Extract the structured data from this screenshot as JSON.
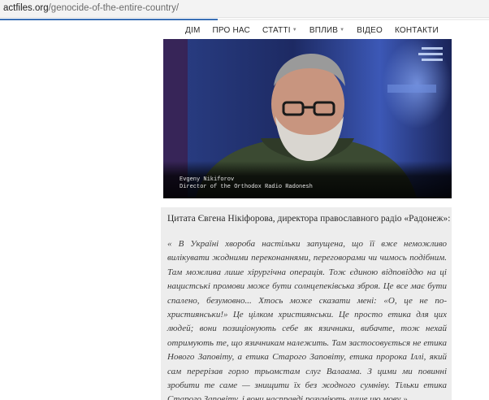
{
  "browser": {
    "url_domain": "actfiles.org",
    "url_path": "/genocide-of-the-entire-country/"
  },
  "nav": {
    "items": [
      {
        "label": "ДІМ",
        "has_dropdown": false
      },
      {
        "label": "ПРО НАС",
        "has_dropdown": false
      },
      {
        "label": "СТАТТІ",
        "has_dropdown": true
      },
      {
        "label": "ВПЛИВ",
        "has_dropdown": true
      },
      {
        "label": "ВІДЕО",
        "has_dropdown": false
      },
      {
        "label": "КОНТАКТИ",
        "has_dropdown": false
      }
    ]
  },
  "video": {
    "caption_name": "Evgeny Nikiforov",
    "caption_title": "Director of the Orthodox Radio Radonesh"
  },
  "quote": {
    "intro": "Цитата Євгена Нікіфорова, директора православного радіо «Радонеж»:",
    "text": "« В Україні хвороба настільки запущена, що її вже неможливо вилікувати жодними переконаннями, переговорами чи чимось подібним. Там можлива лише хірургічна операція. Тож єдиною відповіддю на ці нацистські промови може бути солнцепеківська зброя. Це все має бути спалено, безумовно... Хтось може сказати мені: «О, це не по-християнськи!» Це цілком християнськи. Це просто етика для цих людей; вони позиціонують себе як язичники, вибачте, тож нехай отримують те, що язичникам належить. Там застосовується не етика Нового Заповіту, а етика Старого Заповіту, етика пророка Іллі, який сам перерізав горло трьомстам слуг Валаама. З цими ми повинні зробити те саме — знищити їх без жодного сумніву. Тільки етика Старого Заповіту, і вони насправді розуміють лише цю мову »."
  }
}
